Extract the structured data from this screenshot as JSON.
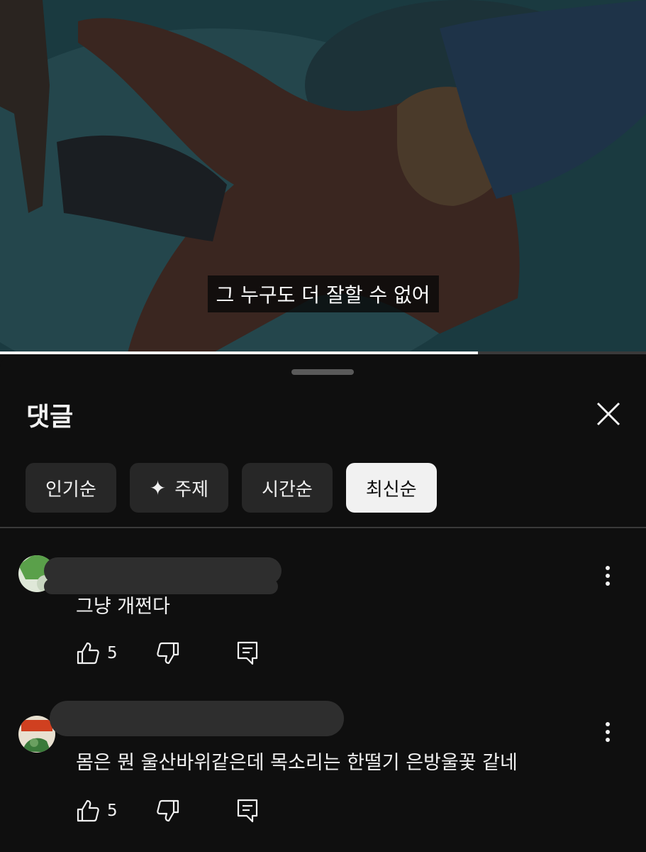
{
  "video": {
    "caption": "그 누구도 더 잘할 수 없어",
    "progress": 0.74
  },
  "comments_panel": {
    "title": "댓글",
    "close_icon": "close-icon",
    "sort_chips": [
      {
        "label": "인기순",
        "active": false
      },
      {
        "label": "주제",
        "icon": "sparkle-icon",
        "active": false
      },
      {
        "label": "시간순",
        "active": false
      },
      {
        "label": "최신순",
        "active": true
      }
    ],
    "comments": [
      {
        "text": "그냥 개쩐다",
        "likes": "5",
        "icons": [
          "like-icon",
          "dislike-icon",
          "reply-icon",
          "more-vert-icon"
        ]
      },
      {
        "text": "몸은 뭔 울산바위같은데 목소리는 한떨기 은방울꽃 같네",
        "likes": "5",
        "icons": [
          "like-icon",
          "dislike-icon",
          "reply-icon",
          "more-vert-icon"
        ]
      }
    ]
  },
  "colors": {
    "background": "#0f0f0f",
    "chip": "#272727",
    "chip_active": "#f1f1f1",
    "text": "#f1f1f1"
  }
}
